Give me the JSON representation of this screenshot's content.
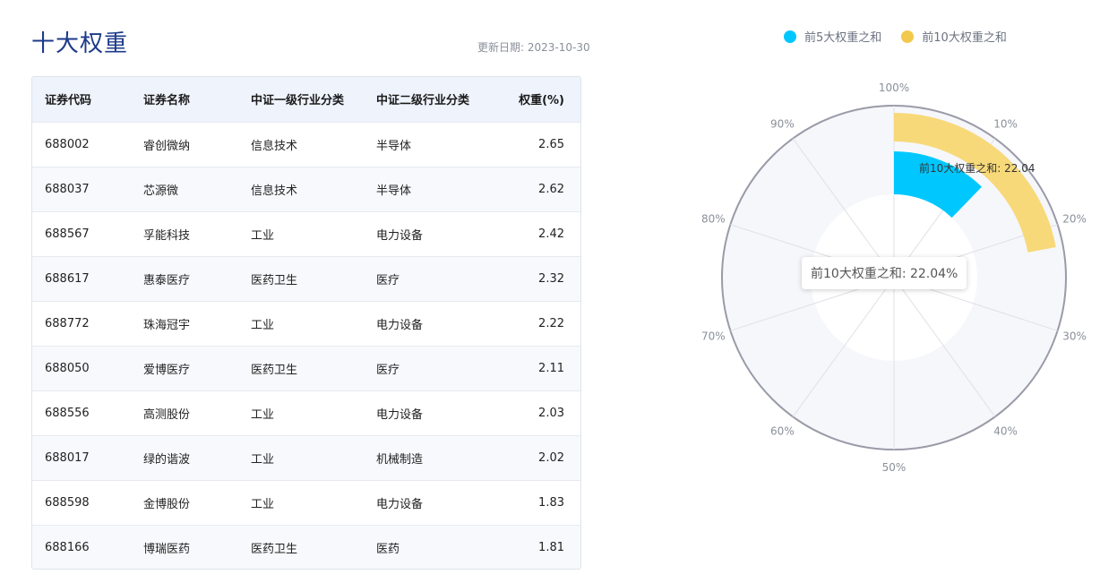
{
  "title": "十大权重",
  "update_date": "更新日期: 2023-10-30",
  "table": {
    "headers": [
      "证券代码",
      "证券名称",
      "中证一级行业分类",
      "中证二级行业分类",
      "权重(%)"
    ],
    "rows": [
      [
        "688002",
        "睿创微纳",
        "信息技术",
        "半导体",
        "2.65"
      ],
      [
        "688037",
        "芯源微",
        "信息技术",
        "半导体",
        "2.62"
      ],
      [
        "688567",
        "孚能科技",
        "工业",
        "电力设备",
        "2.42"
      ],
      [
        "688617",
        "惠泰医疗",
        "医药卫生",
        "医疗",
        "2.32"
      ],
      [
        "688772",
        "珠海冠宇",
        "工业",
        "电力设备",
        "2.22"
      ],
      [
        "688050",
        "爱博医疗",
        "医药卫生",
        "医疗",
        "2.11"
      ],
      [
        "688556",
        "高测股份",
        "工业",
        "电力设备",
        "2.03"
      ],
      [
        "688017",
        "绿的谐波",
        "工业",
        "机械制造",
        "2.02"
      ],
      [
        "688598",
        "金博股份",
        "工业",
        "电力设备",
        "1.83"
      ],
      [
        "688166",
        "博瑞医药",
        "医药卫生",
        "医药",
        "1.81"
      ]
    ]
  },
  "chart_data": {
    "type": "bar",
    "polar": true,
    "categories": [
      "前5大权重之和",
      "前10大权重之和"
    ],
    "values": [
      12.23,
      22.04
    ],
    "colors": [
      "#00c8ff",
      "#f7d97a"
    ],
    "angle_axis": {
      "min": 0,
      "max": 100,
      "ticks": [
        "100%",
        "10%",
        "20%",
        "30%",
        "40%",
        "50%",
        "60%",
        "70%",
        "80%",
        "90%"
      ]
    },
    "bar_label": "前10大权重之和: 22.04",
    "legend": {
      "position": "top-right"
    },
    "tooltip": "前10大权重之和: 22.04%"
  }
}
